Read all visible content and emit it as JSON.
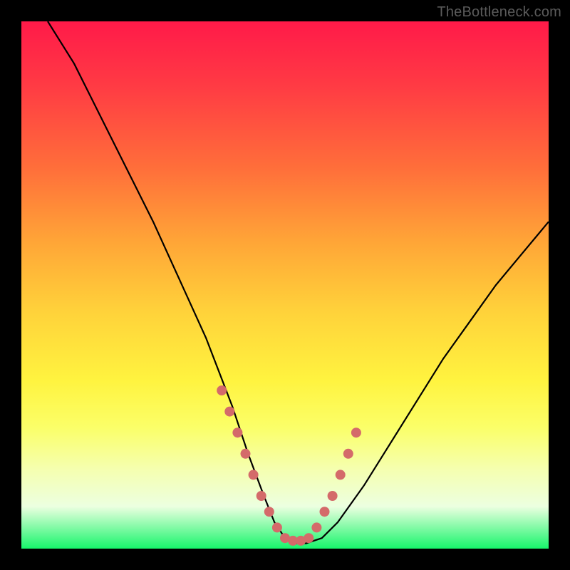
{
  "watermark": "TheBottleneck.com",
  "chart_data": {
    "type": "line",
    "title": "",
    "xlabel": "",
    "ylabel": "",
    "xlim": [
      0,
      100
    ],
    "ylim": [
      0,
      100
    ],
    "series": [
      {
        "name": "bottleneck-curve",
        "x": [
          5,
          10,
          15,
          20,
          25,
          30,
          35,
          40,
          43,
          46,
          48,
          50,
          52,
          54,
          57,
          60,
          65,
          70,
          75,
          80,
          85,
          90,
          95,
          100
        ],
        "y": [
          100,
          92,
          82,
          72,
          62,
          51,
          40,
          27,
          18,
          10,
          5,
          2,
          1,
          1,
          2,
          5,
          12,
          20,
          28,
          36,
          43,
          50,
          56,
          62
        ]
      }
    ],
    "markers": {
      "name": "highlight-points",
      "color": "#d46a6a",
      "x": [
        38,
        39.5,
        41,
        42.5,
        44,
        45.5,
        47,
        48.5,
        50,
        51.5,
        53,
        54.5,
        56,
        57.5,
        59,
        60.5,
        62,
        63.5
      ],
      "y": [
        30,
        26,
        22,
        18,
        14,
        10,
        7,
        4,
        2,
        1.5,
        1.5,
        2,
        4,
        7,
        10,
        14,
        18,
        22
      ]
    }
  }
}
